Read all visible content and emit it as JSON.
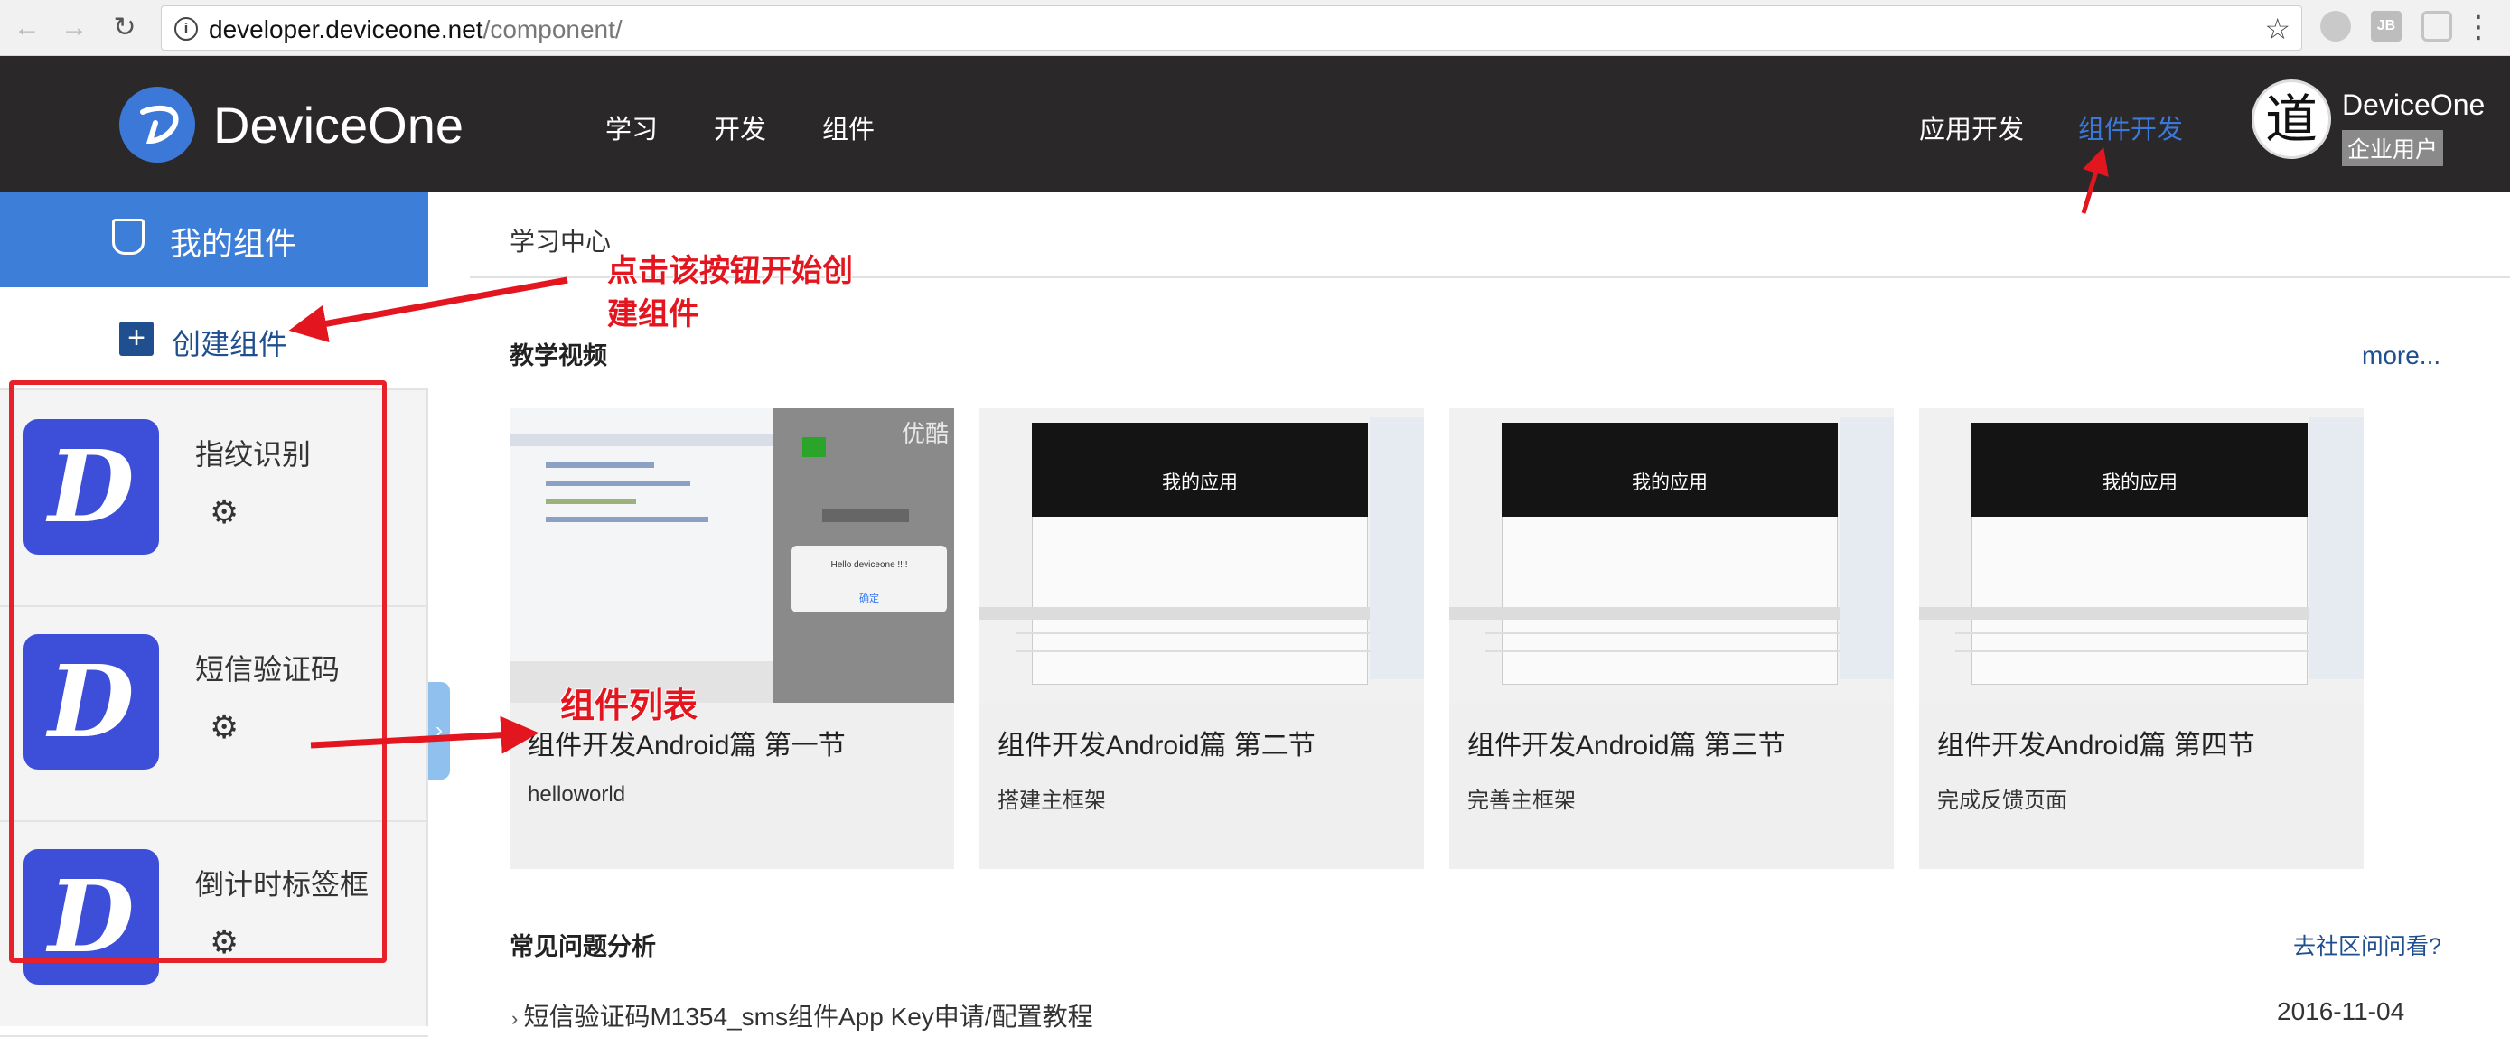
{
  "browser": {
    "url_domain": "developer.deviceone.net",
    "url_path": "/component/",
    "ext_label": "JB"
  },
  "header": {
    "brand": "DeviceOne",
    "nav": [
      "学习",
      "开发",
      "组件"
    ],
    "app_nav": [
      "应用开发",
      "组件开发"
    ],
    "avatar_char": "道",
    "user_name": "DeviceOne",
    "user_badge": "企业用户"
  },
  "sidebar": {
    "title": "我的组件",
    "create_label": "创建组件",
    "components": [
      {
        "name": "指纹识别"
      },
      {
        "name": "短信验证码"
      },
      {
        "name": "倒计时标签框"
      }
    ]
  },
  "main": {
    "breadcrumb": "学习中心",
    "videos_title": "教学视频",
    "more": "more...",
    "videos": [
      {
        "title": "组件开发Android篇   第一节",
        "subtitle": "helloworld"
      },
      {
        "title": "组件开发Android篇   第二节",
        "subtitle": "搭建主框架"
      },
      {
        "title": "组件开发Android篇   第三节",
        "subtitle": "完善主框架"
      },
      {
        "title": "组件开发Android篇   第四节",
        "subtitle": "完成反馈页面"
      }
    ],
    "thumb_text": "我的应用",
    "thumb1_dialog": "Hello deviceone !!!!",
    "thumb1_ok": "确定",
    "thumb1_watermark": "优酷",
    "faq_title": "常见问题分析",
    "faq_link": "去社区问问看?",
    "faq_items": [
      {
        "text": "短信验证码M1354_sms组件App Key申请/配置教程",
        "date": "2016-11-04"
      }
    ]
  },
  "annotations": {
    "create_hint_line1": "点击该按钮开始创",
    "create_hint_line2": "建组件",
    "list_hint": "组件列表"
  },
  "colors": {
    "header_bg": "#2a2828",
    "accent_blue": "#3c7ed8",
    "link_blue": "#1f4f8f",
    "annotation_red": "#e3161f"
  }
}
